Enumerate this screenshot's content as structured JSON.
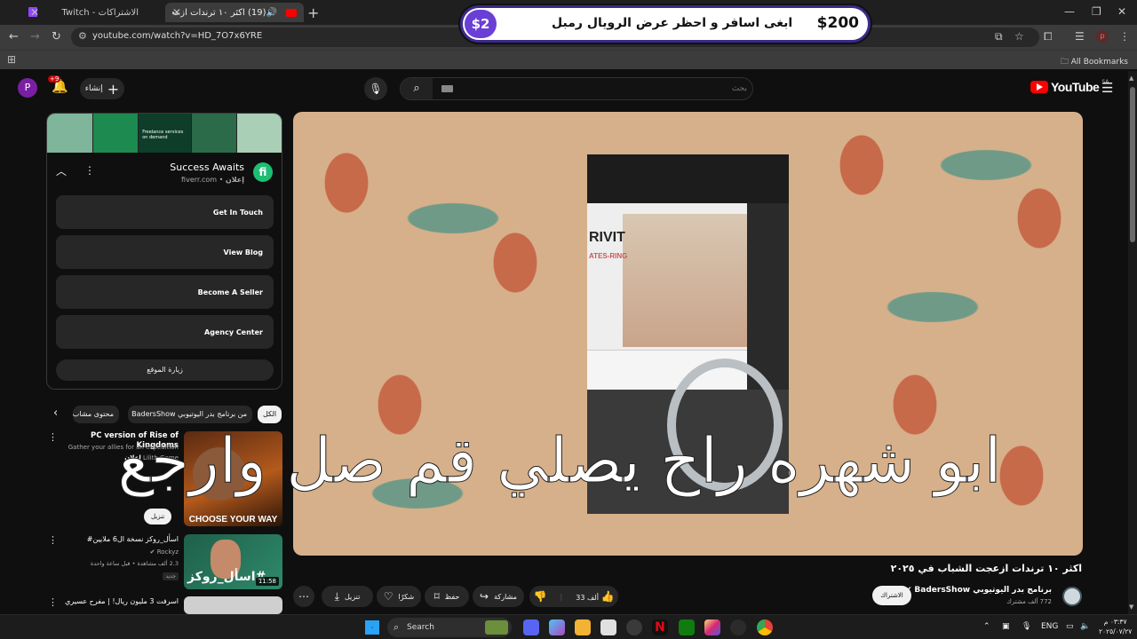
{
  "browser": {
    "tabs": [
      {
        "title": "الاشتراكات - Twitch"
      },
      {
        "title": "(19) اكثر ١٠ ترندات ازعجت الشا..."
      }
    ],
    "new_tab": "+",
    "url": "youtube.com/watch?v=HD_7O7x6YRE",
    "all_bookmarks": "All Bookmarks",
    "profile_initial": "p"
  },
  "banner": {
    "badge": "$2",
    "text": "ابغى اسافر و احظر عرض الرويال رمبل",
    "amount": "$200"
  },
  "youtube": {
    "avatar_initial": "P",
    "notification_count": "+9",
    "create_label": "إنشاء",
    "search_placeholder": "بحث",
    "logo_text": "YouTube",
    "country_code": "SA"
  },
  "ad": {
    "frame_text": "Freelance services on demand",
    "logo_letter": "fi",
    "name": "Success Awaits",
    "sponsor_label": "إعلان",
    "domain": "fiverr.com",
    "links": [
      "Get In Touch",
      "View Blog",
      "Become A Seller",
      "Agency Center"
    ],
    "visit_site": "زيارة الموقع"
  },
  "chips": [
    "الكل",
    "من برنامج بدر اليوتيوبي BadersShow",
    "محتوى مشاب"
  ],
  "recommendations": [
    {
      "title": "PC version of Rise of Kingdoms",
      "description": "Gather your allies for an expedition",
      "sponsor_label": "إعلان",
      "advertiser": "Lilith Game",
      "download_label": "تنزيل",
      "thumb_text": "CHOOSE YOUR WAY"
    },
    {
      "title": "#اسأل_روكز نسخة ال6 ملايين",
      "channel": "Rockyz",
      "meta": "2.3 ألف مشاهدة • قبل ساعة واحدة",
      "badge": "جديد",
      "duration": "11:58",
      "thumb_text": "#اسأل_روكز"
    },
    {
      "title": "اسرفت 3 مليون ريال! | مفرح عسيري"
    }
  ],
  "video": {
    "caption": "ابو شهره راح يصلي قم صل وارجع",
    "box_brand": "RIVIT",
    "box_sub": "ATES-RING",
    "title": "اكثر ١٠ ترندات ازعجت الشباب في ٢٠٢٥",
    "channel": "برنامج بدر اليوتيوبي BadersShow",
    "subscribers": "772 ألف مشترك",
    "subscribe_label": "الاشتراك",
    "likes": "33 ألف",
    "share_label": "مشاركة",
    "save_label": "حفظ",
    "thanks_label": "شكرًا",
    "download_label": "تنزيل"
  },
  "taskbar": {
    "search_label": "Search",
    "language": "ENG",
    "time": "٠٣:٣٧ م",
    "date": "٢٠٢٥/٠٧/٢٧"
  }
}
